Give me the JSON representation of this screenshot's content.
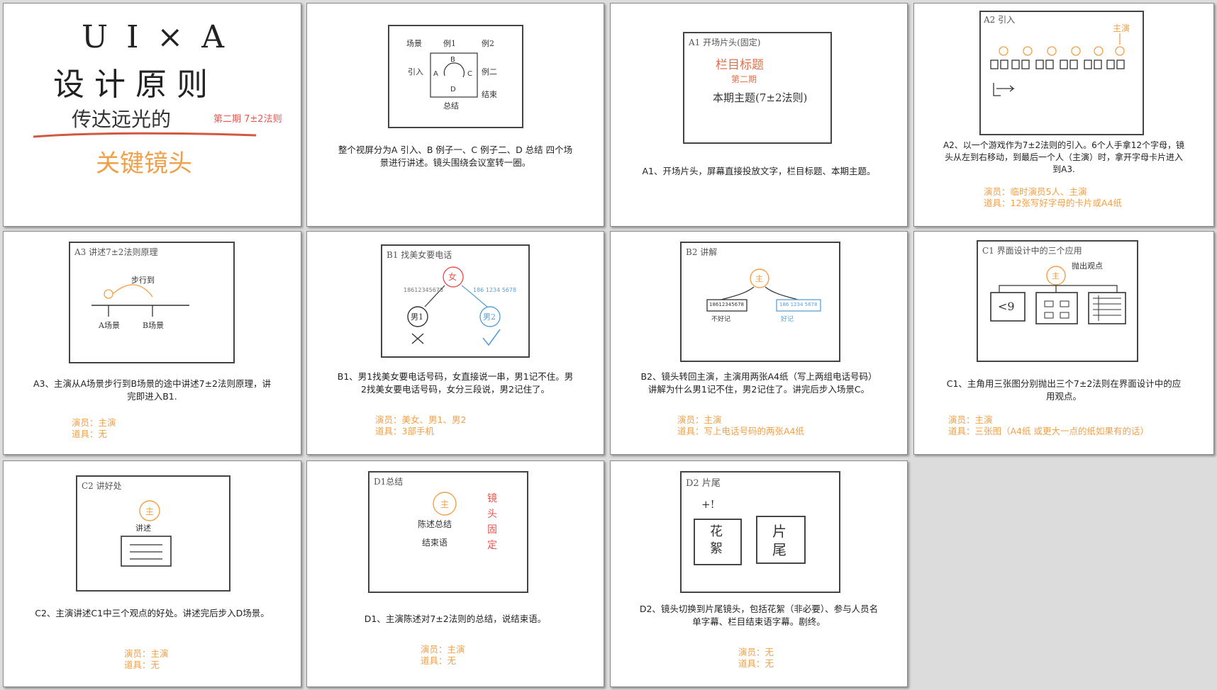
{
  "cover": {
    "title_line1": "U I × A",
    "title_line2": "设 计 原 则",
    "title_line3": "传达远光的",
    "episode_tag": "第二期 7±2法则",
    "subtitle": "关键镜头"
  },
  "cards": [
    {
      "id": "overview",
      "sketch": {
        "labels": [
          "场景",
          "例1",
          "例2",
          "引入",
          "例二",
          "结束",
          "总结",
          "A",
          "B",
          "C",
          "D"
        ]
      },
      "caption": "整个视屏分为A 引入、B 例子一、C 例子二、D 总结 四个场景进行讲述。镜头围绕会议室转一圈。"
    },
    {
      "id": "a1",
      "sketch": {
        "heading": "A1 开场片头(固定)",
        "lines": [
          "栏目标题",
          "第二期",
          "本期主题(7±2法则)"
        ]
      },
      "caption": "A1、开场片头，屏幕直接投放文字，栏目标题、本期主题。"
    },
    {
      "id": "a2",
      "sketch": {
        "heading": "A2 引入",
        "labels": [
          "主演"
        ]
      },
      "caption": "A2、以一个游戏作为7±2法则的引入。6个人手拿12个字母，镜头从左到右移动，到最后一个人（主演）时，拿开字母卡片进入到A3.",
      "actors": "演员：临时演员5人、主演",
      "props": "道具：12张写好字母的卡片或A4纸"
    },
    {
      "id": "a3",
      "sketch": {
        "heading": "A3 讲述7±2法则原理",
        "labels": [
          "步行到",
          "A场景",
          "B场景"
        ]
      },
      "caption": "A3、主演从A场景步行到B场景的途中讲述7±2法则原理，讲完即进入B1.",
      "actors": "演员：主演",
      "props": "道具：无"
    },
    {
      "id": "b1",
      "sketch": {
        "heading": "B1 找美女要电话",
        "labels": [
          "女",
          "男1",
          "男2",
          "18612345678",
          "186 1234 5678"
        ]
      },
      "caption": "B1、男1找美女要电话号码，女直接说一串，男1记不住。男2找美女要电话号码，女分三段说，男2记住了。",
      "actors": "演员：美女、男1、男2",
      "props": "道具：3部手机"
    },
    {
      "id": "b2",
      "sketch": {
        "heading": "B2 讲解",
        "labels": [
          "主",
          "18612345678",
          "186 1234 5678",
          "不好记",
          "好记"
        ]
      },
      "caption": "B2、镜头转回主演，主演用两张A4纸（写上两组电话号码）讲解为什么男1记不住，男2记住了。讲完后步入场景C。",
      "actors": "演员：主演",
      "props": "道具：写上电话号码的两张A4纸"
    },
    {
      "id": "c1",
      "sketch": {
        "heading": "C1 界面设计中的三个应用",
        "labels": [
          "主",
          "抛出观点",
          "<9"
        ]
      },
      "caption": "C1、主角用三张图分别抛出三个7±2法则在界面设计中的应用观点。",
      "actors": "演员：主演",
      "props": "道具：三张图（A4纸 或更大一点的纸如果有的话）"
    },
    {
      "id": "c2",
      "sketch": {
        "heading": "C2 讲好处",
        "labels": [
          "主",
          "讲述"
        ]
      },
      "caption": "C2、主演讲述C1中三个观点的好处。讲述完后步入D场景。",
      "actors": "演员：主演",
      "props": "道具：无"
    },
    {
      "id": "d1",
      "sketch": {
        "heading": "D1总结",
        "labels": [
          "主",
          "陈述总结",
          "结束语",
          "镜头固定"
        ]
      },
      "caption": "D1、主演陈述对7±2法则的总结，说结束语。",
      "actors": "演员：主演",
      "props": "道具：无"
    },
    {
      "id": "d2",
      "sketch": {
        "heading": "D2 片尾",
        "labels": [
          "+!",
          "花絮",
          "片尾"
        ]
      },
      "caption": "D2、镜头切换到片尾镜头，包括花絮（非必要）、参与人员名单字幕、栏目结束语字幕。剧终。",
      "actors": "演员：无",
      "props": "道具：无"
    }
  ]
}
